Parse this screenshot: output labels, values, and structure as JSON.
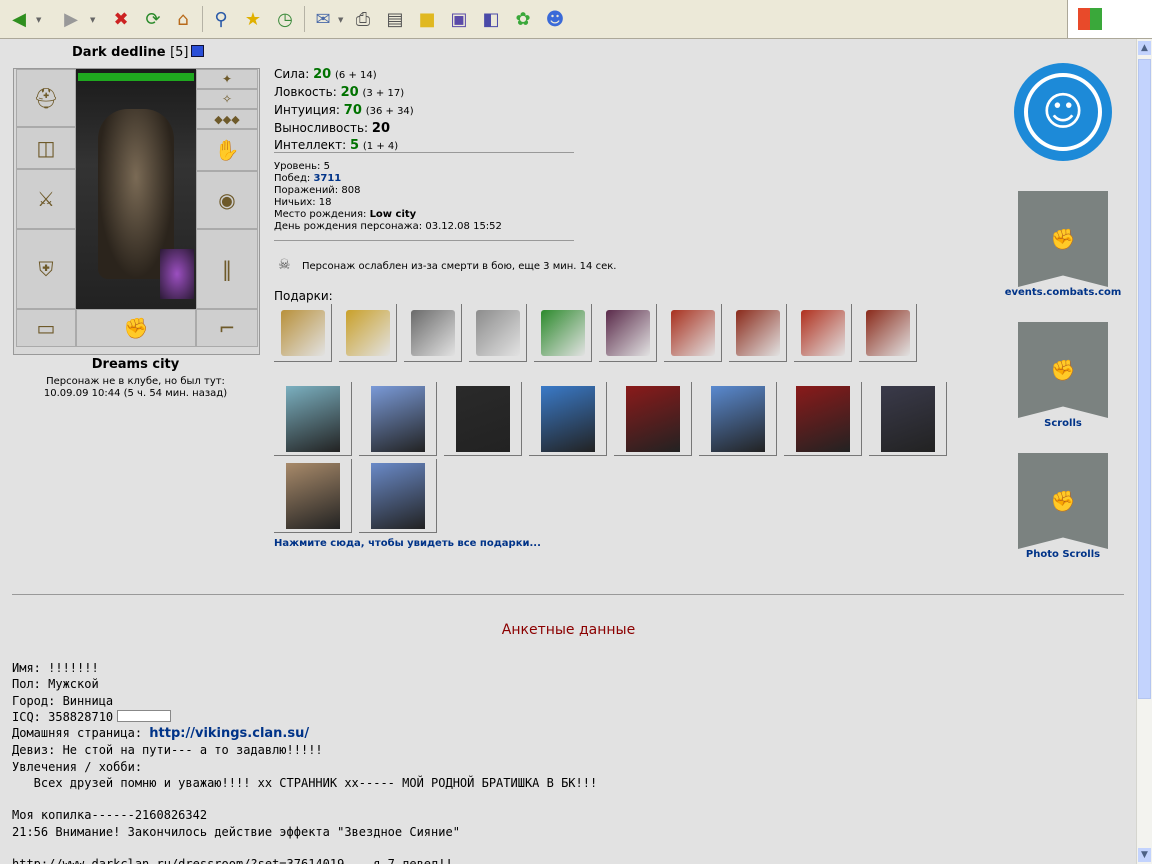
{
  "toolbar": {
    "icons": [
      "back-icon",
      "forward-icon",
      "stop-icon",
      "refresh-icon",
      "home-icon",
      "search-icon",
      "favorites-icon",
      "history-icon",
      "mail-icon",
      "print-icon",
      "edit-icon",
      "notes-icon",
      "messenger-icon",
      "research-icon",
      "icq-icon",
      "contacts-icon"
    ]
  },
  "character": {
    "name": "Dark dedline",
    "level": "[5]",
    "city": "Dreams city",
    "club_note_line1": "Персонаж не в клубе, но был тут:",
    "club_note_line2": "10.09.09 10:44 (5 ч. 54 мин. назад)"
  },
  "stats": [
    {
      "label": "Сила:",
      "value": "20",
      "detail": "(6 + 14)"
    },
    {
      "label": "Ловкость:",
      "value": "20",
      "detail": "(3 + 17)"
    },
    {
      "label": "Интуиция:",
      "value": "70",
      "detail": "(36 + 34)"
    },
    {
      "label": "Выносливость:",
      "value": "20",
      "detail": ""
    },
    {
      "label": "Интеллект:",
      "value": "5",
      "detail": "(1 + 4)"
    }
  ],
  "info": {
    "level_label": "Уровень:",
    "level": "5",
    "wins_label": "Побед:",
    "wins": "3711",
    "losses_label": "Поражений:",
    "losses": "808",
    "draws_label": "Ничьих:",
    "draws": "18",
    "birthplace_label": "Место рождения:",
    "birthplace": "Low city",
    "birthday_label": "День рождения персонажа:",
    "birthday": "03.12.08 15:52"
  },
  "death_note": "Персонаж ослаблен из-за смерти в бою, еще 3 мин. 14 сек.",
  "gifts": {
    "label": "Подарки:",
    "all_link": "Нажмите сюда, чтобы увидеть все подарки...",
    "small_colors": [
      "#b8903a",
      "#c9a02a",
      "#6a6a6a",
      "#8c8c8c",
      "#2d8a2d",
      "#5a2a4a",
      "#a8301e",
      "#8a2a1a",
      "#b0301e",
      "#8a2a1a"
    ],
    "card_colors": [
      "#7bb0c0",
      "#7a9ad8",
      "#2a2a2a",
      "#3a7ac8",
      "#8a1a1a",
      "#5a8ad0",
      "#8a1a1a",
      "#3a3a4a",
      "#a88a6a",
      "#6a8ac8"
    ]
  },
  "badges": {
    "events_caption": "events.combats.com",
    "scrolls_caption": "Scrolls",
    "photo_caption": "Photo Scrolls"
  },
  "profile": {
    "title": "Анкетные данные",
    "name_line": "Имя: !!!!!!!",
    "gender_line": "Пол: Мужской",
    "city_line": "Город: Винница",
    "icq_line": "ICQ: 358828710",
    "homepage_label": "Домашняя страница: ",
    "homepage_url": "http://vikings.clan.su/",
    "motto_line": "Девиз: Не стой на пути--- а то задавлю!!!!!",
    "hobby_label": "Увлечения / хобби:",
    "hobby_line1": "   Всех друзей помню и уважаю!!!! хх СТРАННИК хх----- МОЙ РОДНОЙ БРАТИШКА В БК!!!",
    "hobby_line2": "",
    "hobby_line3": "Моя копилка------2160826342",
    "hobby_line4": "21:56 Внимание! Закончилось действие эффекта \"Звездное Сияние\"",
    "hobby_line5": "",
    "hobby_line6": "http://www.darkclan.ru/dressroom/?set=37614019 ---я 7 левел!!"
  }
}
